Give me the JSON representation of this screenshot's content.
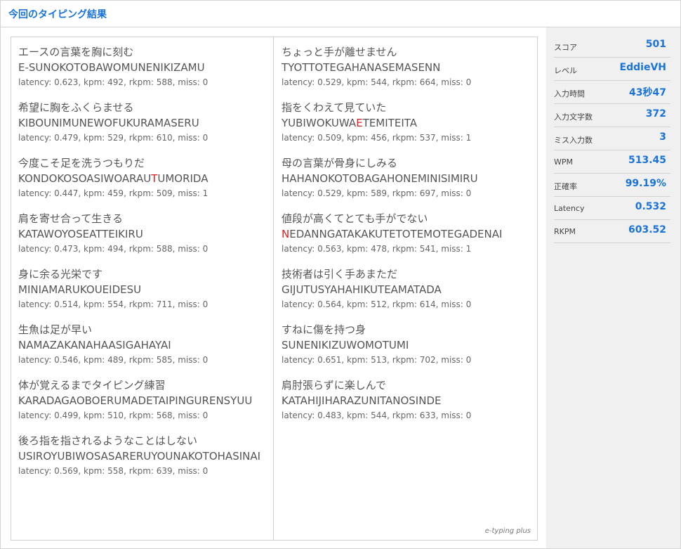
{
  "header": {
    "title": "今回のタイピング結果"
  },
  "brand": "e-typing plus",
  "left_column": [
    {
      "jp": "エースの言葉を胸に刻む",
      "romaji_pre": "E-SUNOKOTOBAWOMUNENIKIZAMU",
      "romaji_miss": "",
      "romaji_post": "",
      "stats": "latency: 0.623, kpm: 492, rkpm: 588, miss: 0"
    },
    {
      "jp": "希望に胸をふくらませる",
      "romaji_pre": "KIBOUNIMUNEWOFUKURAMASERU",
      "romaji_miss": "",
      "romaji_post": "",
      "stats": "latency: 0.479, kpm: 529, rkpm: 610, miss: 0"
    },
    {
      "jp": "今度こそ足を洗うつもりだ",
      "romaji_pre": "KONDOKOSOASIWOARAU",
      "romaji_miss": "T",
      "romaji_post": "UMORIDA",
      "stats": "latency: 0.447, kpm: 459, rkpm: 509, miss: 1"
    },
    {
      "jp": "肩を寄せ合って生きる",
      "romaji_pre": "KATAWOYOSEATTEIKIRU",
      "romaji_miss": "",
      "romaji_post": "",
      "stats": "latency: 0.473, kpm: 494, rkpm: 588, miss: 0"
    },
    {
      "jp": "身に余る光栄です",
      "romaji_pre": "MINIAMARUKOUEIDESU",
      "romaji_miss": "",
      "romaji_post": "",
      "stats": "latency: 0.514, kpm: 554, rkpm: 711, miss: 0"
    },
    {
      "jp": "生魚は足が早い",
      "romaji_pre": "NAMAZAKANAHAASIGAHAYAI",
      "romaji_miss": "",
      "romaji_post": "",
      "stats": "latency: 0.546, kpm: 489, rkpm: 585, miss: 0"
    },
    {
      "jp": "体が覚えるまでタイピング練習",
      "romaji_pre": "KARADAGAOBOERUMADETAIPINGURENSYUU",
      "romaji_miss": "",
      "romaji_post": "",
      "stats": "latency: 0.499, kpm: 510, rkpm: 568, miss: 0"
    },
    {
      "jp": "後ろ指を指されるようなことはしない",
      "romaji_pre": "USIROYUBIWOSASARERUYOUNAKOTOHASINAI",
      "romaji_miss": "",
      "romaji_post": "",
      "stats": "latency: 0.569, kpm: 558, rkpm: 639, miss: 0"
    }
  ],
  "right_column": [
    {
      "jp": "ちょっと手が離せません",
      "romaji_pre": "TYOTTOTEGAHANASEMASENN",
      "romaji_miss": "",
      "romaji_post": "",
      "stats": "latency: 0.529, kpm: 544, rkpm: 664, miss: 0"
    },
    {
      "jp": "指をくわえて見ていた",
      "romaji_pre": "YUBIWOKUWA",
      "romaji_miss": "E",
      "romaji_post": "TEMITEITA",
      "stats": "latency: 0.509, kpm: 456, rkpm: 537, miss: 1"
    },
    {
      "jp": "母の言葉が骨身にしみる",
      "romaji_pre": "HAHANOKOTOBAGAHONEMINISIMIRU",
      "romaji_miss": "",
      "romaji_post": "",
      "stats": "latency: 0.529, kpm: 589, rkpm: 697, miss: 0"
    },
    {
      "jp": "値段が高くてとても手がでない",
      "romaji_pre": "",
      "romaji_miss": "N",
      "romaji_post": "EDANNGATAKAKUTETOTEMOTEGADENAI",
      "stats": "latency: 0.563, kpm: 478, rkpm: 541, miss: 1"
    },
    {
      "jp": "技術者は引く手あまただ",
      "romaji_pre": "GIJUTUSYAHAHIKUTEAMATADA",
      "romaji_miss": "",
      "romaji_post": "",
      "stats": "latency: 0.564, kpm: 512, rkpm: 614, miss: 0"
    },
    {
      "jp": "すねに傷を持つ身",
      "romaji_pre": "SUNENIKIZUWOMOTUMI",
      "romaji_miss": "",
      "romaji_post": "",
      "stats": "latency: 0.651, kpm: 513, rkpm: 702, miss: 0"
    },
    {
      "jp": "肩肘張らずに楽しんで",
      "romaji_pre": "KATAHIJIHARAZUNITANOSINDE",
      "romaji_miss": "",
      "romaji_post": "",
      "stats": "latency: 0.483, kpm: 544, rkpm: 633, miss: 0"
    }
  ],
  "summary": [
    {
      "key": "score",
      "label": "スコア",
      "value": "501"
    },
    {
      "key": "level",
      "label": "レベル",
      "value": "EddieVH"
    },
    {
      "key": "input-time",
      "label": "入力時間",
      "value": "43秒47"
    },
    {
      "key": "input-chars",
      "label": "入力文字数",
      "value": "372"
    },
    {
      "key": "miss-count",
      "label": "ミス入力数",
      "value": "3"
    },
    {
      "key": "wpm",
      "label": "WPM",
      "value": "513.45"
    },
    {
      "key": "accuracy",
      "label": "正確率",
      "value": "99.19%"
    },
    {
      "key": "latency",
      "label": "Latency",
      "value": "0.532"
    },
    {
      "key": "rkpm",
      "label": "RKPM",
      "value": "603.52"
    }
  ],
  "colors": {
    "accent": "#1a73d9",
    "miss": "#e02020"
  }
}
